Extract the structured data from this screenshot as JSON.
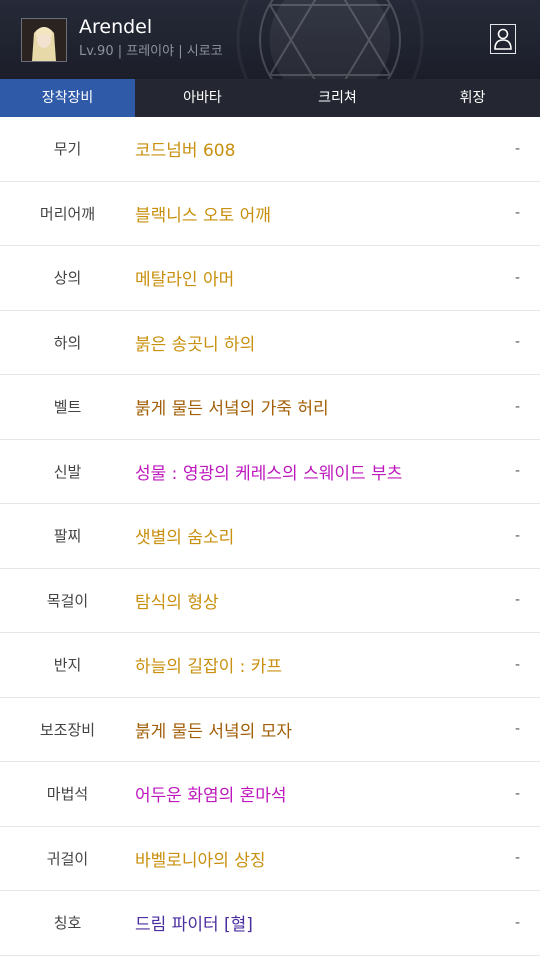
{
  "header": {
    "name": "Arendel",
    "subtitle": "Lv.90 | 프레이야 | 시로코",
    "profile_icon": "person-icon"
  },
  "tabs": [
    {
      "label": "장착장비",
      "active": true
    },
    {
      "label": "아바타",
      "active": false
    },
    {
      "label": "크리쳐",
      "active": false
    },
    {
      "label": "휘장",
      "active": false
    }
  ],
  "equipment": [
    {
      "slot": "무기",
      "item": "코드넘버 608",
      "color": "#c8900e",
      "value": "-"
    },
    {
      "slot": "머리어깨",
      "item": "블랙니스 오토 어깨",
      "color": "#c8900e",
      "value": "-"
    },
    {
      "slot": "상의",
      "item": "메탈라인 아머",
      "color": "#c8900e",
      "value": "-"
    },
    {
      "slot": "하의",
      "item": "붉은 송곳니 하의",
      "color": "#c8900e",
      "value": "-"
    },
    {
      "slot": "벨트",
      "item": "붉게 물든 서녘의 가죽 허리",
      "color": "#a35f08",
      "value": "-"
    },
    {
      "slot": "신발",
      "item": "성물 : 영광의 케레스의 스웨이드 부츠",
      "color": "#bd17bd",
      "value": "-"
    },
    {
      "slot": "팔찌",
      "item": "샛별의 숨소리",
      "color": "#c8900e",
      "value": "-"
    },
    {
      "slot": "목걸이",
      "item": "탐식의 형상",
      "color": "#c8900e",
      "value": "-"
    },
    {
      "slot": "반지",
      "item": "하늘의 길잡이 : 카프",
      "color": "#c8900e",
      "value": "-"
    },
    {
      "slot": "보조장비",
      "item": "붉게 물든 서녘의 모자",
      "color": "#a35f08",
      "value": "-"
    },
    {
      "slot": "마법석",
      "item": "어두운 화염의 혼마석",
      "color": "#bd17bd",
      "value": "-"
    },
    {
      "slot": "귀걸이",
      "item": "바벨로니아의 상징",
      "color": "#c8900e",
      "value": "-"
    },
    {
      "slot": "칭호",
      "item": "드림 파이터 [혈]",
      "color": "#4b2ea0",
      "value": "-"
    }
  ]
}
